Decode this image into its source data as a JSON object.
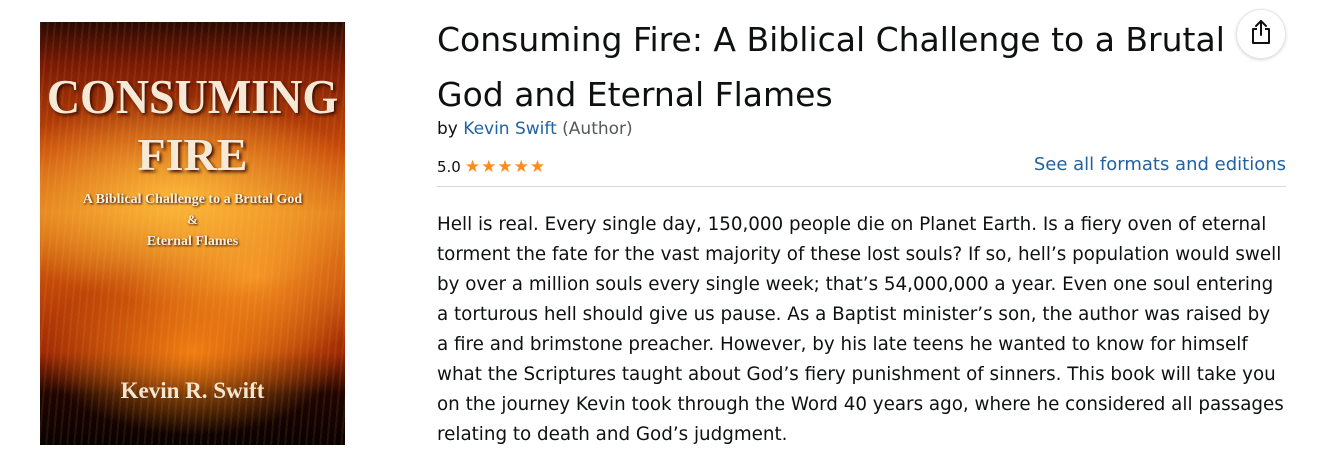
{
  "book": {
    "title": "Consuming Fire: A Biblical Challenge to a Brutal God and Eternal Flames",
    "by_label": "by",
    "author": "Kevin Swift",
    "author_role": "(Author)",
    "rating": "5.0",
    "stars": 5,
    "formats_link": "See all formats and editions",
    "description": "Hell is real. Every single day, 150,000 people die on Planet Earth. Is a fiery oven of eternal torment the fate for the vast majority of these lost souls? If so, hell’s population would swell by over a million souls every single week; that’s 54,000,000 a year. Even one soul entering a torturous hell should give us pause. As a Baptist minister’s son, the author was raised by a fire and brimstone preacher. However, by his late teens he wanted to know for himself what the Scriptures taught about God’s fiery punishment of sinners. This book will take you on the journey Kevin took through the Word 40 years ago, where he considered all passages relating to death and God’s judgment."
  },
  "cover": {
    "title_line1": "CONSUMING",
    "title_line2": "FIRE",
    "subtitle_line1": "A Biblical Challenge to a Brutal God",
    "subtitle_line2": "&",
    "subtitle_line3": "Eternal Flames",
    "author": "Kevin R. Swift"
  },
  "icons": {
    "share": "share-icon",
    "star": "star-icon"
  },
  "colors": {
    "link": "#2162a1",
    "star": "#ff8c1a",
    "text": "#0f1111"
  }
}
